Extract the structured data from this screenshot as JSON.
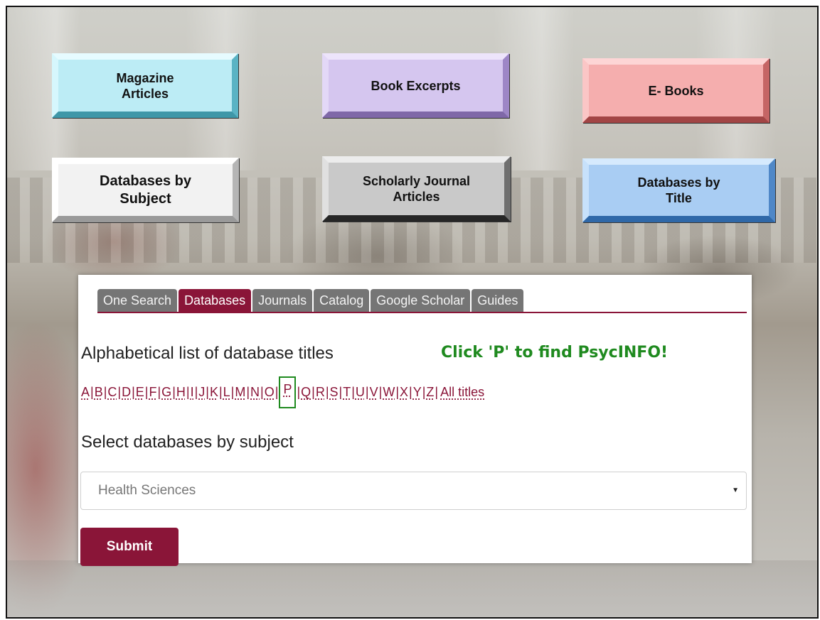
{
  "category_buttons": {
    "magazine": [
      "Magazine",
      "Articles"
    ],
    "book_excerpts": [
      "Book Excerpts"
    ],
    "ebooks": [
      "E- Books"
    ],
    "db_subject": [
      "Databases by",
      "Subject"
    ],
    "scholarly": [
      "Scholarly Journal",
      "Articles"
    ],
    "db_title": [
      "Databases by",
      "Title"
    ]
  },
  "tabs": [
    "One Search",
    "Databases",
    "Journals",
    "Catalog",
    "Google Scholar",
    "Guides"
  ],
  "active_tab": "Databases",
  "alpha_heading": "Alphabetical list of database titles",
  "callout": "Click 'P' to find PsycINFO!",
  "letters": [
    "A",
    "B",
    "C",
    "D",
    "E",
    "F",
    "G",
    "H",
    "I",
    "J",
    "K",
    "L",
    "M",
    "N",
    "O",
    "P",
    "Q",
    "R",
    "S",
    "T",
    "U",
    "V",
    "W",
    "X",
    "Y",
    "Z"
  ],
  "highlighted_letter": "P",
  "all_titles": "All titles",
  "subject_heading": "Select databases by subject",
  "subject_select": {
    "selected": "Health Sciences"
  },
  "submit_label": "Submit",
  "colors": {
    "brand": "#8a1538",
    "callout": "#1f8a1f",
    "tab_inactive": "#757575"
  }
}
